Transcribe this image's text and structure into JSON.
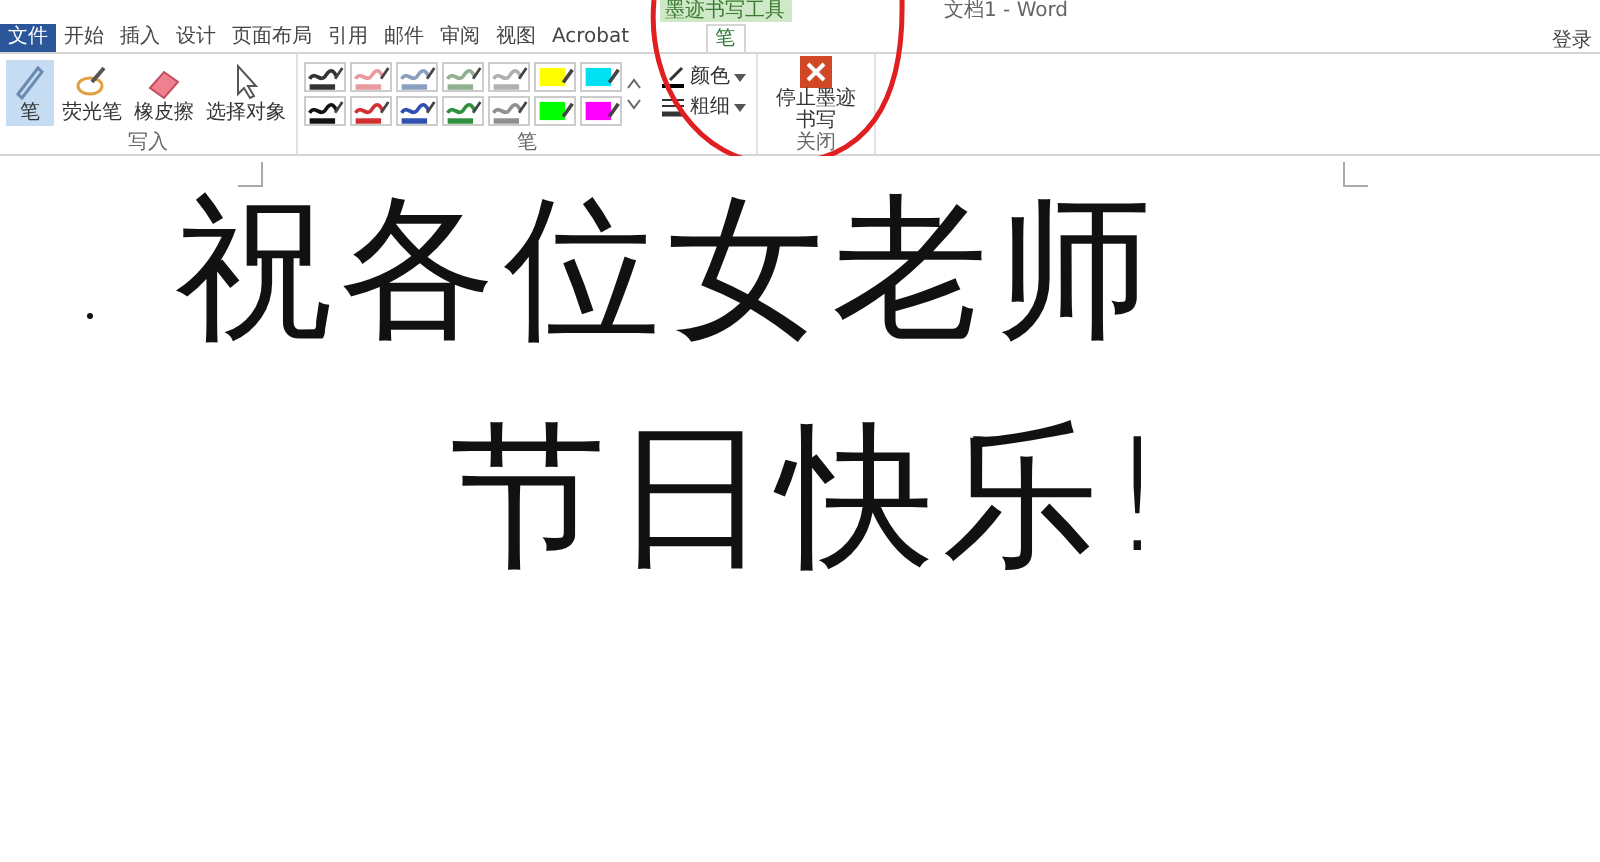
{
  "window": {
    "title": "文档1 - Word",
    "account": "登录"
  },
  "contextual_tab_header": "墨迹书写工具",
  "tabs": [
    {
      "label": "文件",
      "kind": "file",
      "selected": false
    },
    {
      "label": "开始",
      "kind": "normal",
      "selected": false
    },
    {
      "label": "插入",
      "kind": "normal",
      "selected": false
    },
    {
      "label": "设计",
      "kind": "normal",
      "selected": false
    },
    {
      "label": "页面布局",
      "kind": "normal",
      "selected": false
    },
    {
      "label": "引用",
      "kind": "normal",
      "selected": false
    },
    {
      "label": "邮件",
      "kind": "normal",
      "selected": false
    },
    {
      "label": "审阅",
      "kind": "normal",
      "selected": false
    },
    {
      "label": "视图",
      "kind": "normal",
      "selected": false
    },
    {
      "label": "Acrobat",
      "kind": "normal",
      "selected": false
    },
    {
      "label": "笔",
      "kind": "contextual",
      "selected": true
    }
  ],
  "ribbon": {
    "write_group": {
      "label": "写入",
      "tools": [
        {
          "label": "笔",
          "kind": "pen",
          "selected": true
        },
        {
          "label": "荧光笔",
          "kind": "highlighter",
          "selected": false
        },
        {
          "label": "橡皮擦",
          "kind": "eraser",
          "selected": false
        },
        {
          "label": "选择对象",
          "kind": "select",
          "selected": false
        }
      ]
    },
    "pens_group": {
      "label": "笔",
      "pens": [
        {
          "kind": "pen",
          "color": "#333333"
        },
        {
          "kind": "pen",
          "color": "#e89aa0"
        },
        {
          "kind": "pen",
          "color": "#8aa0c0"
        },
        {
          "kind": "pen",
          "color": "#90b090"
        },
        {
          "kind": "pen",
          "color": "#b0b0b0"
        },
        {
          "kind": "highlighter",
          "color": "#ffff00"
        },
        {
          "kind": "highlighter",
          "color": "#00e0f0"
        },
        {
          "kind": "pen",
          "color": "#111111"
        },
        {
          "kind": "pen",
          "color": "#d03030"
        },
        {
          "kind": "pen",
          "color": "#3050b0"
        },
        {
          "kind": "pen",
          "color": "#309040"
        },
        {
          "kind": "pen",
          "color": "#909090"
        },
        {
          "kind": "highlighter",
          "color": "#00ff00"
        },
        {
          "kind": "highlighter",
          "color": "#ff00ff"
        }
      ],
      "options": [
        {
          "label": "颜色",
          "kind": "color"
        },
        {
          "label": "粗细",
          "kind": "thickness"
        }
      ]
    },
    "close_group": {
      "label": "关闭",
      "button": "停止墨迹书写"
    }
  },
  "document": {
    "handwriting_lines": [
      "祝各位女老师",
      "节日快乐!"
    ]
  }
}
